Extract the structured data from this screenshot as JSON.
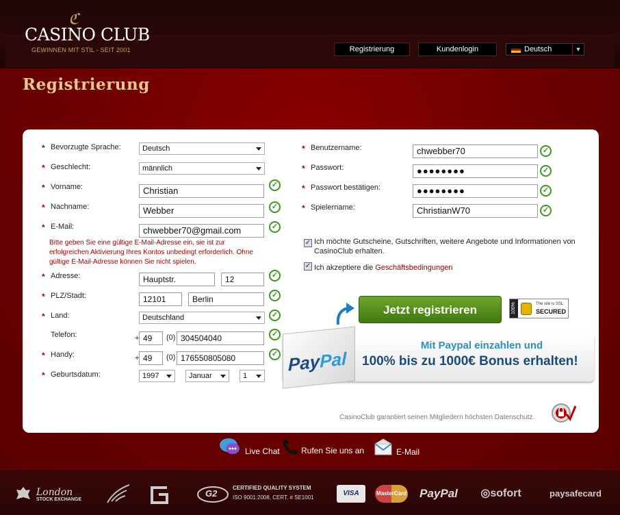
{
  "header": {
    "logo_mark": "ℭ",
    "logo_name": "CASINO CLUB",
    "logo_tagline": "GEWINNEN MIT STIL - SEIT 2001",
    "register_label": "Registrierung",
    "login_label": "Kundenlogin",
    "language": "Deutsch"
  },
  "page": {
    "title": "Registrierung"
  },
  "form_left": {
    "language_label": "Bevorzugte Sprache:",
    "language_value": "Deutsch",
    "gender_label": "Geschlecht:",
    "gender_value": "männlich",
    "firstname_label": "Vorname:",
    "firstname_value": "Christian",
    "lastname_label": "Nachname:",
    "lastname_value": "Webber",
    "email_label": "E-Mail:",
    "email_value": "chwebber70@gmail.com",
    "email_hint": "Bitte geben Sie eine gültige E-Mail-Adresse ein, sie ist zur erfolgreichen Aktivierung Ihres Kontos unbedingt erforderlich. Ohne gültige E-Mail-Adresse können Sie nicht spielen.",
    "address_label": "Adresse:",
    "street_value": "Hauptstr.",
    "number_value": "12",
    "zipcity_label": "PLZ/Stadt:",
    "zip_value": "12101",
    "city_value": "Berlin",
    "country_label": "Land:",
    "country_value": "Deutschland",
    "phone_label": "Telefon:",
    "phone_plus": "+",
    "phone_cc": "49",
    "phone_zero": "(0)",
    "phone_value": "304504040",
    "mobile_label": "Handy:",
    "mobile_plus": "+",
    "mobile_cc": "49",
    "mobile_zero": "(0)",
    "mobile_value": "176550805080",
    "birth_label": "Geburtsdatum:",
    "birth_year": "1997",
    "birth_month": "Januar",
    "birth_day": "1"
  },
  "form_right": {
    "username_label": "Benutzername:",
    "username_value": "chwebber70",
    "password_label": "Passwort:",
    "password_value": "●●●●●●●●",
    "password_confirm_label": "Passwort bestätigen:",
    "password_confirm_value": "●●●●●●●●",
    "playername_label": "Spielername:",
    "playername_value": "ChristianW70",
    "newsletter_text": "Ich möchte Gutscheine, Gutschriften, weitere Angebote und Informationen von CasinoClub erhalten.",
    "terms_text": "Ich akzeptiere die ",
    "terms_link": "Geschäftsbedingungen",
    "register_button": "Jetzt registrieren",
    "ssl_pct": "100%",
    "ssl_line1": "The site is SSL",
    "ssl_line2": "SECURED"
  },
  "paypal": {
    "logo_a": "Pay",
    "logo_b": "Pal",
    "line1": "Mit Paypal einzahlen und",
    "line2": "100% bis zu 1000€ Bonus erhalten!"
  },
  "privacy_text": "CasinoClub garantiert seinen Mitgliedern höchsten Datenschutz.",
  "contact": {
    "chat": "Live Chat",
    "phone": "Rufen Sie uns an",
    "email": "E-Mail"
  },
  "footer": {
    "lse_1": "London",
    "lse_2": "STOCK EXCHANGE",
    "g2": "G2",
    "quality_1": "CERTIFIED QUALITY SYSTEM",
    "quality_2": "ISO 9001:2008, CERT. # SE1001",
    "visa": "VISA",
    "mastercard": "MasterCard",
    "paypal": "PayPal",
    "sofort": "sofort",
    "paysafecard": "paysafecard"
  },
  "colors": {
    "brand_red": "#6a0000",
    "gold": "#e8c88a",
    "green": "#3a9a1a",
    "link_red": "#a00000"
  }
}
